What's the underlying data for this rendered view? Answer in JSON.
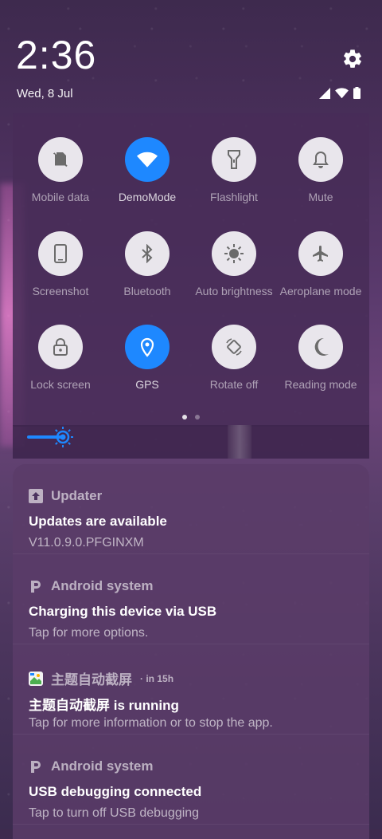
{
  "status": {
    "time": "2:36",
    "date": "Wed, 8 Jul",
    "icons": [
      "signal-icon",
      "wifi-icon",
      "battery-icon"
    ]
  },
  "quick_settings": {
    "tiles": [
      {
        "label": "Mobile data",
        "icon": "mobile-data-off-icon",
        "active": false
      },
      {
        "label": "DemoMode",
        "icon": "wifi-icon",
        "active": true
      },
      {
        "label": "Flashlight",
        "icon": "flashlight-icon",
        "active": false
      },
      {
        "label": "Mute",
        "icon": "bell-icon",
        "active": false
      },
      {
        "label": "Screenshot",
        "icon": "screenshot-icon",
        "active": false
      },
      {
        "label": "Bluetooth",
        "icon": "bluetooth-icon",
        "active": false
      },
      {
        "label": "Auto brightness",
        "icon": "brightness-icon",
        "active": false
      },
      {
        "label": "Aeroplane mode",
        "icon": "airplane-icon",
        "active": false
      },
      {
        "label": "Lock screen",
        "icon": "lock-icon",
        "active": false
      },
      {
        "label": "GPS",
        "icon": "location-icon",
        "active": true
      },
      {
        "label": "Rotate off",
        "icon": "rotate-icon",
        "active": false
      },
      {
        "label": "Reading mode",
        "icon": "moon-icon",
        "active": false
      }
    ],
    "page_count": 2,
    "current_page": 1,
    "brightness_level": 0.1,
    "accent": "#1e88ff"
  },
  "notifications": [
    {
      "app": "Updater",
      "icon": "updater-icon",
      "time": "",
      "title": "Updates are available",
      "body": "V11.0.9.0.PFGINXM"
    },
    {
      "app": "Android system",
      "icon": "android-system-icon",
      "time": "",
      "title": "Charging this device via USB",
      "body": "Tap for more options."
    },
    {
      "app": "主题自动截屏",
      "icon": "theme-app-icon",
      "time": "in 15h",
      "title": "主题自动截屏 is running",
      "body": "Tap for more information or to stop the app."
    },
    {
      "app": "Android system",
      "icon": "android-system-icon",
      "time": "",
      "title": "USB debugging connected",
      "body": "Tap to turn off USB debugging"
    }
  ]
}
